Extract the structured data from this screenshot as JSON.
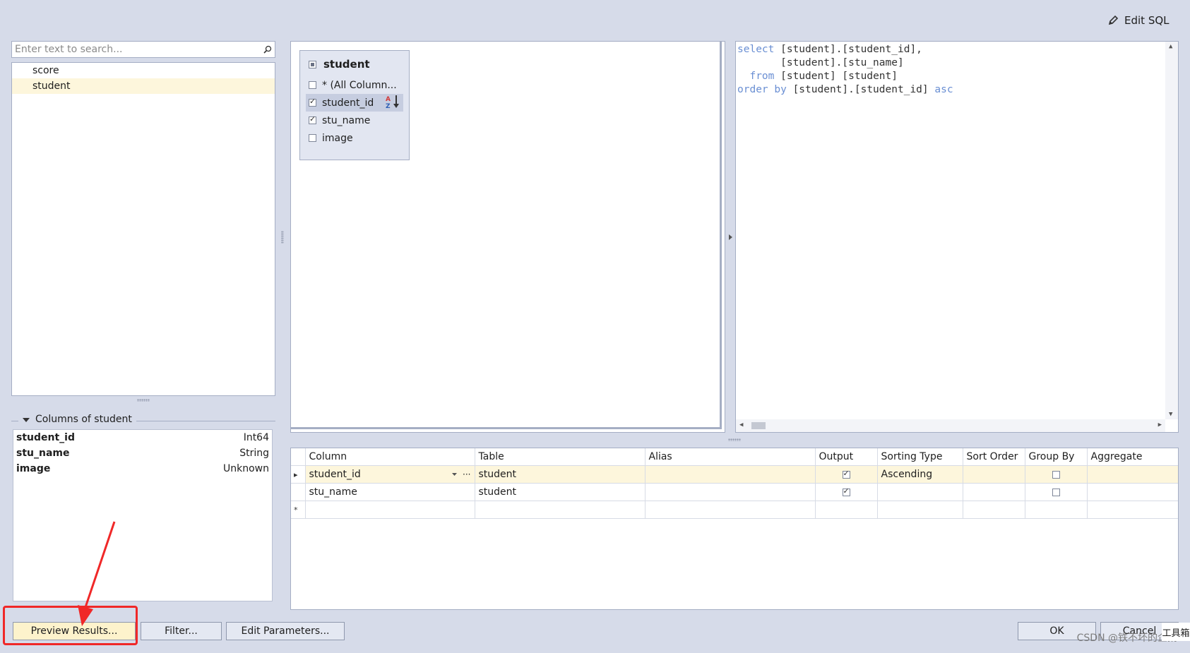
{
  "toolbar": {
    "edit_sql": "Edit SQL"
  },
  "search": {
    "placeholder": "Enter text to search..."
  },
  "tables": [
    {
      "name": "score"
    },
    {
      "name": "student"
    }
  ],
  "columns_group": {
    "caption": "Columns of student",
    "rows": [
      {
        "name": "student_id",
        "type": "Int64"
      },
      {
        "name": "stu_name",
        "type": "String"
      },
      {
        "name": "image",
        "type": "Unknown"
      }
    ]
  },
  "diagram": {
    "table_name": "student",
    "columns": [
      {
        "label": "* (All Column...",
        "checked": false
      },
      {
        "label": "student_id",
        "checked": true,
        "sort_icon": "sort-az-desc-icon"
      },
      {
        "label": "stu_name",
        "checked": true
      },
      {
        "label": "image",
        "checked": false
      }
    ]
  },
  "sql": {
    "lines": [
      {
        "kw": "select",
        "rest": " [student].[student_id],"
      },
      {
        "kw": "",
        "rest": "       [student].[stu_name]"
      },
      {
        "kw": "  from",
        "rest": " [student] [student]"
      },
      {
        "kw": "order by",
        "rest": " [student].[student_id] ",
        "kw2": "asc"
      }
    ]
  },
  "grid": {
    "headers": [
      "Column",
      "Table",
      "Alias",
      "Output",
      "Sorting Type",
      "Sort Order",
      "Group By",
      "Aggregate"
    ],
    "rows": [
      {
        "indicator": "▸",
        "column": "student_id",
        "table": "student",
        "alias": "",
        "output": true,
        "sorting_type": "Ascending",
        "sort_order": "",
        "group_by": false,
        "aggregate": ""
      },
      {
        "indicator": "",
        "column": "stu_name",
        "table": "student",
        "alias": "",
        "output": true,
        "sorting_type": "",
        "sort_order": "",
        "group_by": false,
        "aggregate": ""
      }
    ],
    "new_row_indicator": "*",
    "ellipsis": "···"
  },
  "buttons": {
    "preview": "Preview Results...",
    "filter": "Filter...",
    "edit_parameters": "Edit Parameters...",
    "ok": "OK",
    "cancel": "Cancel"
  },
  "watermark": "CSDN @铁不坏的企鹅",
  "corner_badge": "工具箱",
  "colors": {
    "accent_keyword": "#6a8fd3",
    "selected_row": "#fdf6dc",
    "annotation_red": "#f02828"
  }
}
